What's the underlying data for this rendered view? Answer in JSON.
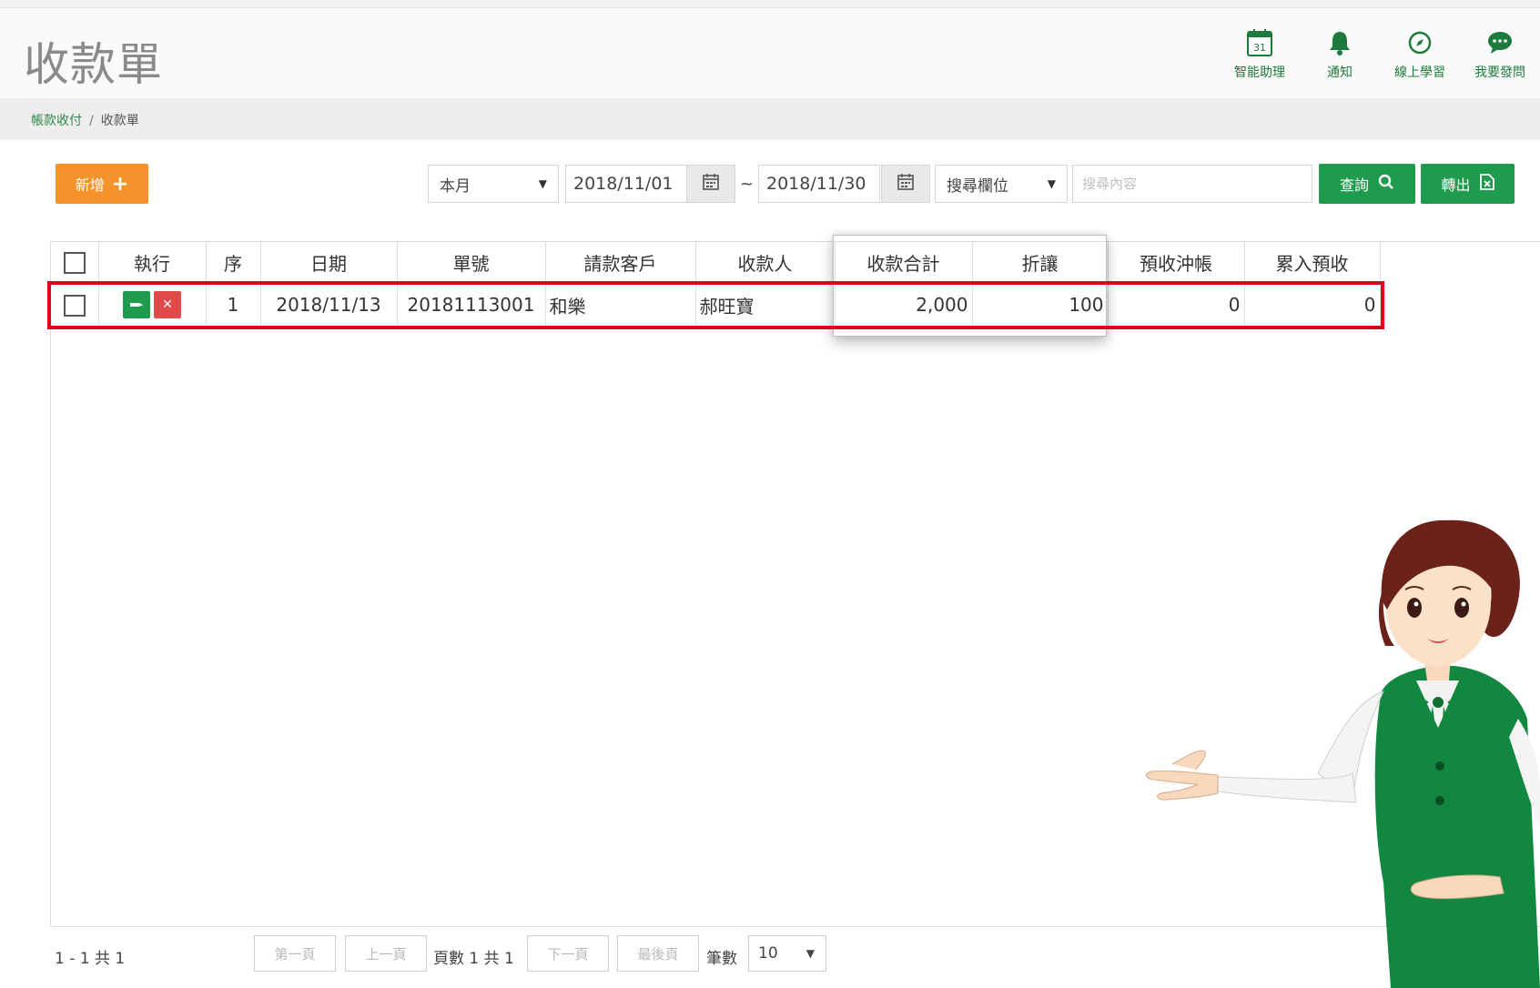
{
  "header": {
    "title": "收款單",
    "icons": [
      {
        "name": "calendar-icon",
        "glyph": "31",
        "label": "智能助理"
      },
      {
        "name": "bell-icon",
        "label": "通知"
      },
      {
        "name": "compass-icon",
        "label": "線上學習"
      },
      {
        "name": "chat-icon",
        "label": "我要發問"
      }
    ]
  },
  "breadcrumb": {
    "parent": "帳款收付",
    "separator": "/",
    "current": "收款單"
  },
  "toolbar": {
    "add_label": "新增",
    "period_select": "本月",
    "date_from": "2018/11/01",
    "date_sep": "~",
    "date_to": "2018/11/30",
    "field_select": "搜尋欄位",
    "search_placeholder": "搜尋內容",
    "query_label": "查詢",
    "export_label": "轉出"
  },
  "table": {
    "columns": [
      "執行",
      "序",
      "日期",
      "單號",
      "請款客戶",
      "收款人",
      "收款合計",
      "折讓",
      "預收沖帳",
      "累入預收"
    ],
    "rows": [
      {
        "seq": "1",
        "date": "2018/11/13",
        "number": "20181113001",
        "customer": "和樂",
        "payee": "郝旺寶",
        "total": "2,000",
        "discount": "100",
        "prepaid_offset": "0",
        "prepaid_added": "0"
      }
    ]
  },
  "pager": {
    "range": "1 - 1 共 1",
    "first": "第一頁",
    "prev": "上一頁",
    "page_info": "頁數 1 共 1",
    "next": "下一頁",
    "last": "最後頁",
    "size_label": "筆數",
    "size_value": "10"
  },
  "colors": {
    "brand_green": "#1f9b4e",
    "add_orange": "#f5922b",
    "delete_red": "#e04a4a",
    "highlight_red": "#e0001b"
  }
}
